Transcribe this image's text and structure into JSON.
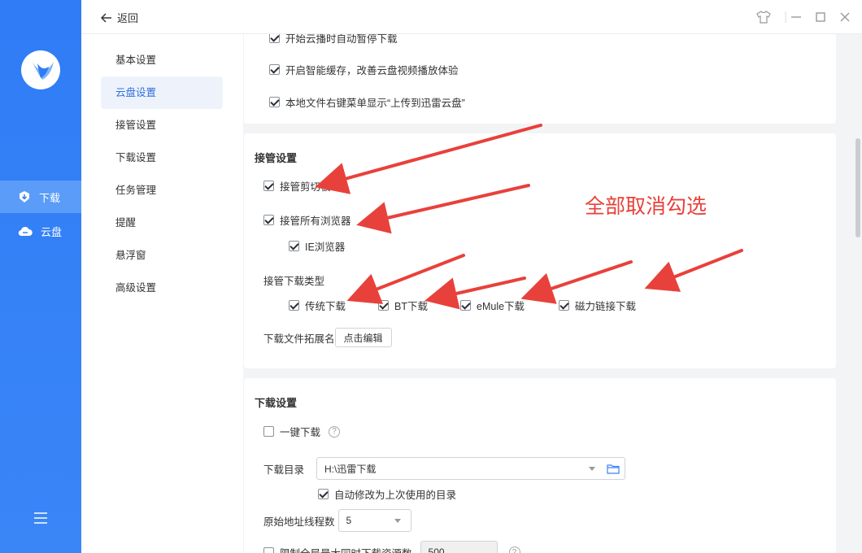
{
  "rail": {
    "items": [
      {
        "label": "下载",
        "icon": "download-icon"
      },
      {
        "label": "云盘",
        "icon": "cloud-icon"
      }
    ]
  },
  "topbar": {
    "back_label": "返回"
  },
  "subnav": {
    "items": [
      "基本设置",
      "云盘设置",
      "接管设置",
      "下载设置",
      "任务管理",
      "提醒",
      "悬浮窗",
      "高级设置"
    ],
    "active": "云盘设置"
  },
  "cloud_card": {
    "opt1": "开始云播时自动暂停下载",
    "opt2": "开启智能缓存，改善云盘视频播放体验",
    "opt3": "本地文件右键菜单显示“上传到迅雷云盘”"
  },
  "takeover": {
    "title": "接管设置",
    "clipboard": "接管剪切板",
    "all_browsers": "接管所有浏览器",
    "ie_browser": "IE浏览器",
    "types_label": "接管下载类型",
    "types": [
      "传统下载",
      "BT下载",
      "eMule下载",
      "磁力链接下载"
    ],
    "ext_label": "下载文件拓展名",
    "edit_button": "点击编辑"
  },
  "download": {
    "title": "下载设置",
    "one_click": "一键下载",
    "help": "?",
    "dir_label": "下载目录",
    "dir_value": "H:\\迅雷下载",
    "auto_dir": "自动修改为上次使用的目录",
    "threads_label": "原始地址线程数",
    "threads_value": "5",
    "limit_label": "限制全局最大同时下载资源数",
    "limit_value": "500"
  },
  "annotation": {
    "text": "全部取消勾选",
    "color": "#e8413b"
  }
}
